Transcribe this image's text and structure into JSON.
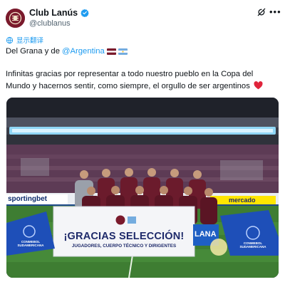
{
  "tweet": {
    "author_name": "Club Lanús",
    "author_handle": "@clublanus",
    "translate_label": "显示翻译",
    "line1_prefix": "Del Grana y de",
    "line1_mention": "@Argentina",
    "body_line1": "Infinitas gracias por representar a todo nuestro pueblo en la Copa del",
    "body_line2": "Mundo y hacernos sentir, como siempre, el orgullo de ser argentinos",
    "icons": [
      "avatar-club-crest",
      "verified-badge-icon",
      "grok-icon",
      "more-options-icon",
      "translate-icon",
      "flag-lanus",
      "flag-argentina",
      "red-heart-emoji"
    ]
  },
  "photo": {
    "banner_line1": "¡GRACIAS SELECCIÓN!",
    "banner_line2": "JUGADORES, CUERPO TÉCNICO Y DIRIGENTES",
    "ad_left": "sportingbet",
    "ad_right": "mercado",
    "ad_mid": "LANA",
    "board_left": "CONMEBOL SUDAMERICANA",
    "board_right": "CONMEBOL SUDAMERICANA",
    "colors": {
      "accent_blue": "#1d9bf0",
      "club_garnet": "#7a1a2c",
      "pitch_green": "#3e7d32"
    }
  }
}
